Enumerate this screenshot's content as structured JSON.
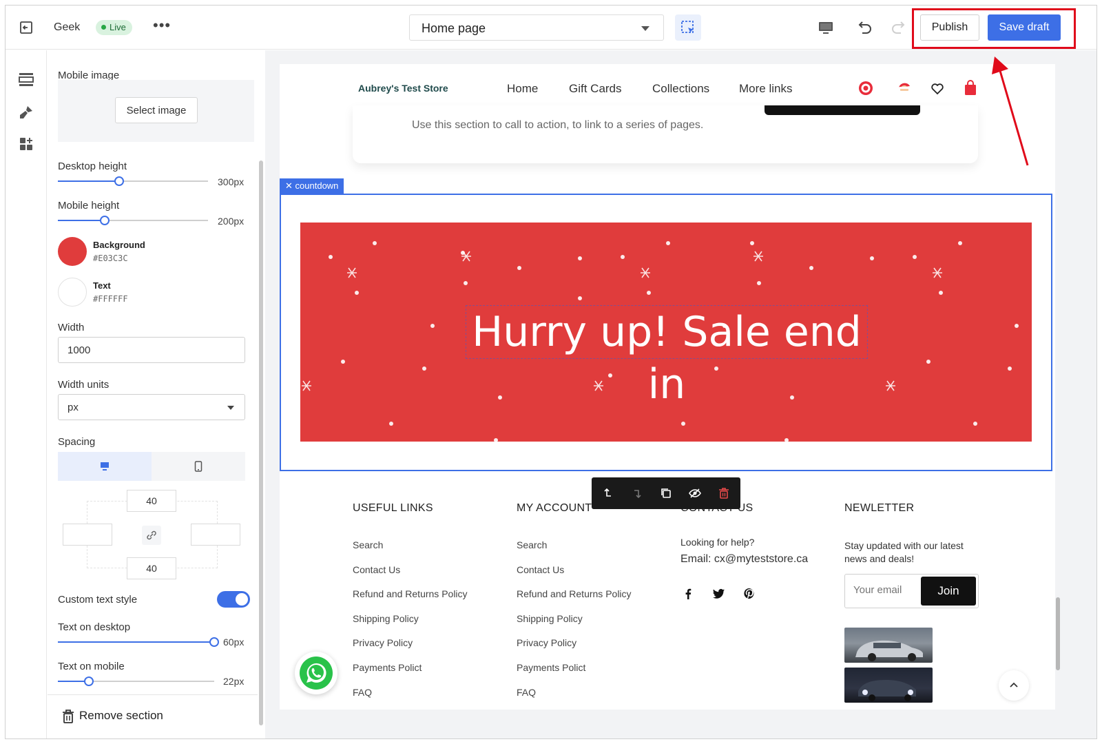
{
  "topbar": {
    "store_name": "Geek",
    "status": "Live",
    "more": "•••",
    "page_select": "Home page",
    "publish_label": "Publish",
    "save_draft_label": "Save draft"
  },
  "colors": {
    "accent": "#3d6fe6",
    "highlight": "#e00a1a",
    "banner_bg": "#E03C3C",
    "banner_text": "#FFFFFF"
  },
  "panel": {
    "mobile_image_label": "Mobile image",
    "select_image_label": "Select image",
    "desktop_height_label": "Desktop height",
    "desktop_height_value": "300px",
    "desktop_height_fraction": 0.41,
    "mobile_height_label": "Mobile height",
    "mobile_height_value": "200px",
    "mobile_height_fraction": 0.31,
    "background_label": "Background",
    "background_hex": "#E03C3C",
    "text_label": "Text",
    "text_hex": "#FFFFFF",
    "width_label": "Width",
    "width_value": "1000",
    "width_units_label": "Width units",
    "width_units_value": "px",
    "spacing_label": "Spacing",
    "spacing_top": "40",
    "spacing_bottom": "40",
    "spacing_left": "",
    "spacing_right": "",
    "custom_text_style_label": "Custom text style",
    "custom_text_style_on": true,
    "text_desktop_label": "Text on desktop",
    "text_desktop_value": "60px",
    "text_desktop_fraction": 1.0,
    "text_mobile_label": "Text on mobile",
    "text_mobile_value": "22px",
    "text_mobile_fraction": 0.2,
    "remove_section_label": "Remove section"
  },
  "preview": {
    "store_name": "Aubrey's Test Store",
    "nav": [
      "Home",
      "Gift Cards",
      "Collections",
      "More links"
    ],
    "cta_text": "Use this section to call to action, to link to a series of pages.",
    "section_tag": "countdown",
    "banner_title": "Hurry up! Sale end in",
    "footer": {
      "useful_links_title": "USEFUL LINKS",
      "my_account_title": "MY ACCOUNT",
      "contact_title": "CONTACT US",
      "newsletter_title": "NEWLETTER",
      "useful_links": [
        "Search",
        "Contact Us",
        "Refund and Returns Policy",
        "Shipping Policy",
        "Privacy Policy",
        "Payments Polict",
        "FAQ"
      ],
      "my_account_links": [
        "Search",
        "Contact Us",
        "Refund and Returns Policy",
        "Shipping Policy",
        "Privacy Policy",
        "Payments Polict",
        "FAQ"
      ],
      "contact_help": "Looking for help?",
      "contact_email": "Email:  cx@myteststore.ca",
      "newsletter_text": "Stay updated with our latest news and deals!",
      "email_placeholder": "Your email",
      "join_label": "Join"
    }
  }
}
